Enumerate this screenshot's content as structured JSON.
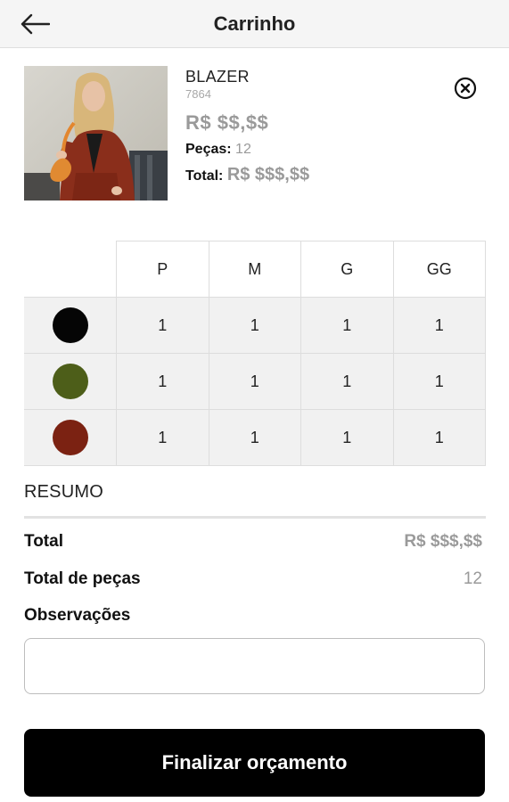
{
  "header": {
    "title": "Carrinho",
    "back_icon": "arrow-left-icon"
  },
  "product": {
    "name": "BLAZER",
    "code": "7864",
    "price": "R$ $$,$$",
    "pieces_label": "Peças:",
    "pieces_value": "12",
    "total_label": "Total:",
    "total_value": "R$ $$$,$$",
    "remove_icon": "close-circle-icon"
  },
  "size_grid": {
    "sizes": [
      "P",
      "M",
      "G",
      "GG"
    ],
    "rows": [
      {
        "color": "#050505",
        "quantities": [
          "1",
          "1",
          "1",
          "1"
        ]
      },
      {
        "color": "#4d5e19",
        "quantities": [
          "1",
          "1",
          "1",
          "1"
        ]
      },
      {
        "color": "#7b2212",
        "quantities": [
          "1",
          "1",
          "1",
          "1"
        ]
      }
    ]
  },
  "summary": {
    "title": "RESUMO",
    "total_label": "Total",
    "total_value": "R$ $$$,$$",
    "pieces_label": "Total de peças",
    "pieces_value": "12"
  },
  "notes": {
    "label": "Observações",
    "value": "",
    "placeholder": ""
  },
  "actions": {
    "finalize_label": "Finalizar orçamento"
  }
}
